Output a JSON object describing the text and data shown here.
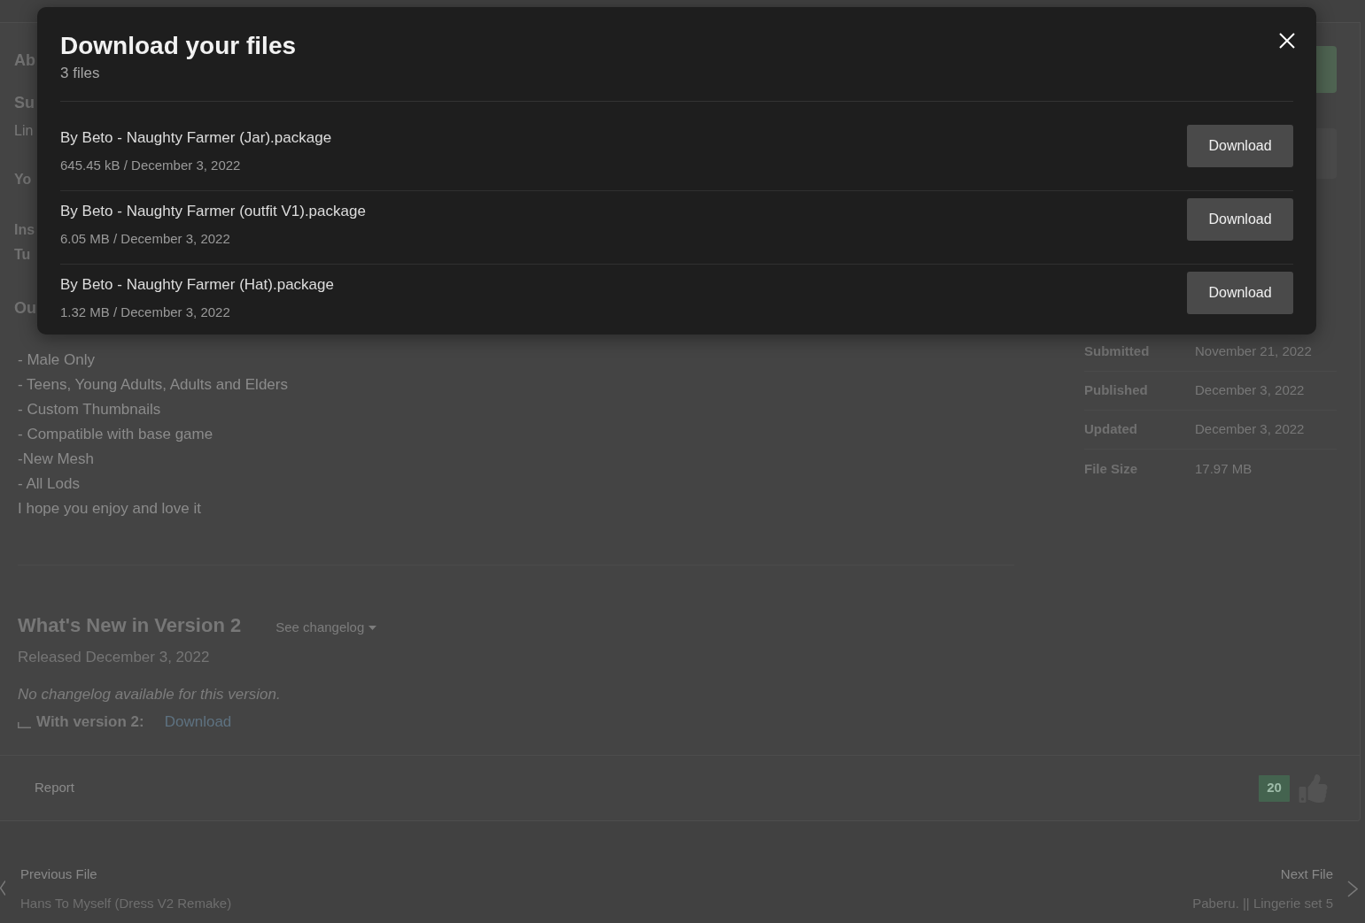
{
  "dialog": {
    "title": "Download your files",
    "subtitle": "3 files",
    "files": [
      {
        "name": "By Beto - Naughty Farmer (Jar).package",
        "meta": "645.45 kB / December 3, 2022",
        "button": "Download"
      },
      {
        "name": "By Beto - Naughty Farmer (outfit V1).package",
        "meta": "6.05 MB / December 3, 2022",
        "button": "Download"
      },
      {
        "name": "By Beto - Naughty Farmer (Hat).package",
        "meta": "1.32 MB / December 3, 2022",
        "button": "Download"
      }
    ]
  },
  "page": {
    "fragments": [
      {
        "kind": "heading",
        "text": "Ab"
      },
      {
        "kind": "heading",
        "text": "Su"
      },
      {
        "kind": "text",
        "text": "Lin"
      },
      {
        "kind": "label",
        "text": "Yo"
      },
      {
        "kind": "label",
        "text": "Ins"
      },
      {
        "kind": "label",
        "text": "Tu"
      },
      {
        "kind": "heading",
        "text": "Ou"
      }
    ],
    "features": [
      "- Male Only",
      "- Teens, Young Adults, Adults and Elders",
      "- Custom Thumbnails",
      "- Compatible with base game",
      "-New Mesh",
      "- All Lods",
      "I hope you enjoy and love it"
    ],
    "whats_new": {
      "title": "What's New in Version 2",
      "changelog_toggle": "See changelog",
      "released": "Released December 3, 2022",
      "note": "No changelog available for this version.",
      "with_version_label": "With version 2:",
      "download_link": "Download"
    },
    "details": [
      {
        "label": "Submitted",
        "value": "November 21, 2022"
      },
      {
        "label": "Published",
        "value": "December 3, 2022"
      },
      {
        "label": "Updated",
        "value": "December 3, 2022"
      },
      {
        "label": "File Size",
        "value": "17.97 MB"
      }
    ],
    "footer": {
      "report": "Report",
      "likes": "20"
    },
    "pagination": {
      "previous": {
        "label": "Previous File",
        "title": "Hans To Myself (Dress V2 Remake)"
      },
      "next": {
        "label": "Next File",
        "title": "Paberu. || Lingerie set 5"
      }
    }
  }
}
